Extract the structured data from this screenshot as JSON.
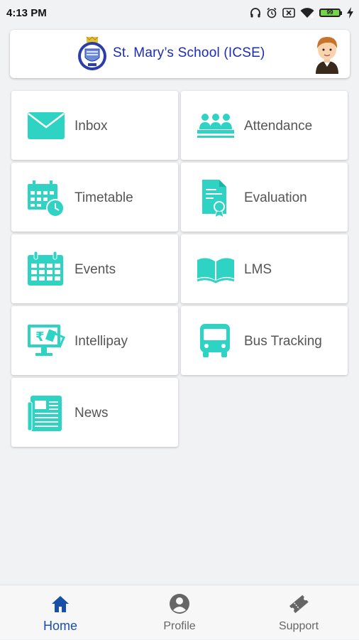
{
  "status_bar": {
    "time": "4:13 PM",
    "battery": "99"
  },
  "header": {
    "school_name": "St. Mary’s School (ICSE)"
  },
  "tiles": [
    {
      "label": "Inbox",
      "icon": "mail-icon"
    },
    {
      "label": "Attendance",
      "icon": "attendance-icon"
    },
    {
      "label": "Timetable",
      "icon": "timetable-icon"
    },
    {
      "label": "Evaluation",
      "icon": "evaluation-icon"
    },
    {
      "label": "Events",
      "icon": "calendar-icon"
    },
    {
      "label": "LMS",
      "icon": "book-icon"
    },
    {
      "label": "Intellipay",
      "icon": "payment-icon"
    },
    {
      "label": "Bus Tracking",
      "icon": "bus-icon"
    },
    {
      "label": "News",
      "icon": "newspaper-icon"
    }
  ],
  "bottom_nav": {
    "items": [
      {
        "label": "Home",
        "icon": "home-icon",
        "active": true
      },
      {
        "label": "Profile",
        "icon": "profile-icon",
        "active": false
      },
      {
        "label": "Support",
        "icon": "ticket-icon",
        "active": false
      }
    ]
  },
  "colors": {
    "accent": "#2ed3c4",
    "brand_blue": "#1c2bb5",
    "active_nav": "#1a4fa8"
  }
}
